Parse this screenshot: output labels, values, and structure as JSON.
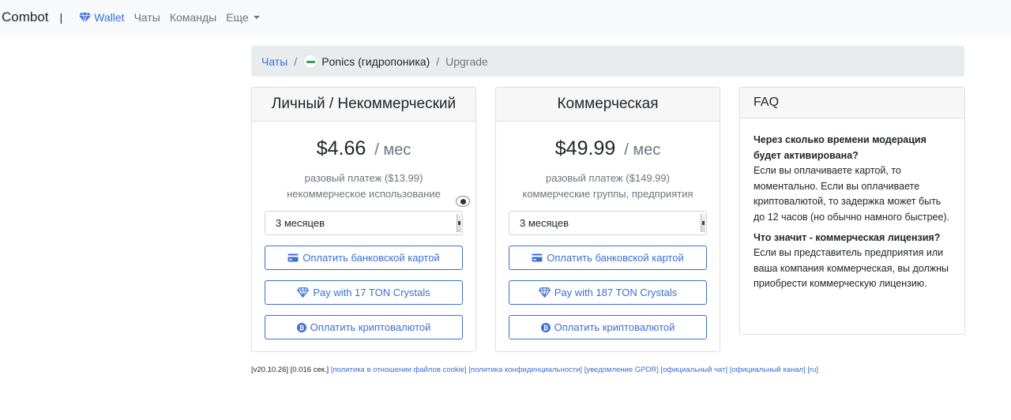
{
  "navbar": {
    "brand": "Combot",
    "separator": "|",
    "links": [
      {
        "label": "Wallet",
        "icon": "diamond-icon"
      },
      {
        "label": "Чаты"
      },
      {
        "label": "Команды"
      },
      {
        "label": "Еще"
      }
    ]
  },
  "breadcrumb": {
    "chats": "Чаты",
    "separator": "/",
    "chat_name": "Ponics (гидропоника)",
    "current": "Upgrade"
  },
  "plans": [
    {
      "title": "Личный / Некоммерческий",
      "price": "$4.66",
      "per": "/ мес",
      "one_time": "разовый платеж ($13.99)",
      "usage": "некоммерческое использование",
      "period": "3 месяцев",
      "pay_card": "Оплатить банковской картой",
      "pay_ton": "Pay with 17 TON Crystals",
      "pay_crypto": "Оплатить криптовалютой"
    },
    {
      "title": "Коммерческая",
      "price": "$49.99",
      "per": "/ мес",
      "one_time": "разовый платеж ($149.99)",
      "usage": "коммерческие группы, предприятия",
      "period": "3 месяцев",
      "pay_card": "Оплатить банковской картой",
      "pay_ton": "Pay with 187 TON Crystals",
      "pay_crypto": "Оплатить криптовалютой"
    }
  ],
  "faq": {
    "title": "FAQ",
    "items": [
      {
        "question": "Через сколько времени модерация будет активирована?",
        "answer": "Если вы оплачиваете картой, то моментально. Если вы оплачиваете криптовалютой, то задержка может быть до 12 часов (но обычно намного быстрее)."
      },
      {
        "question": "Что значит - коммерческая лицензия?",
        "answer": "Если вы представитель предприятия или ваша компания коммерческая, вы должны приобрести коммерческую лицензию."
      }
    ]
  },
  "footer": {
    "version": "[v20.10.26]",
    "timing": "[0.016 сек.]",
    "links": [
      "[политика в отношении файлов cookie]",
      "[политика конфиденциальности]",
      "[уведомление GPDR]",
      "[официальный чат]",
      "[официальный канал]",
      "[ru]"
    ]
  },
  "colors": {
    "accent": "#3b6fd4",
    "muted": "#6c757d",
    "navbar_bg": "#f8f9fa",
    "breadcrumb_bg": "#e9ecef"
  }
}
